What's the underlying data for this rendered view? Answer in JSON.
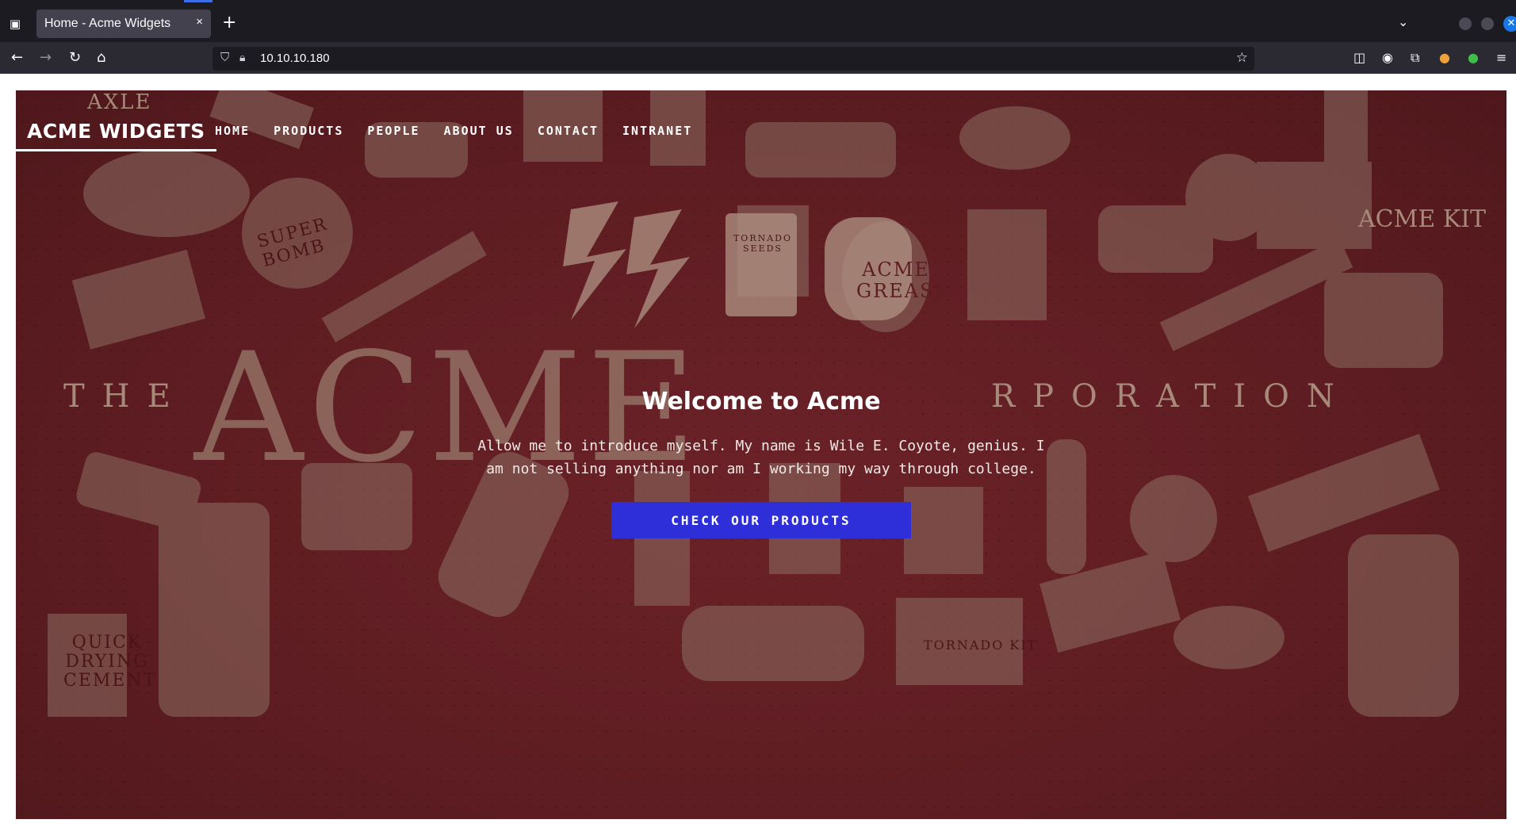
{
  "browser": {
    "tab_title": "Home - Acme Widgets",
    "tab_close": "×",
    "new_tab": "+",
    "url": "10.10.10.180"
  },
  "page": {
    "brand": "ACME WIDGETS",
    "menu": [
      "HOME",
      "PRODUCTS",
      "PEOPLE",
      "ABOUT US",
      "CONTACT",
      "INTRANET"
    ],
    "hero_title": "Welcome to Acme",
    "hero_text": "Allow me to introduce myself. My name is Wile E. Coyote, genius. I am not selling anything nor am I working my way through college.",
    "cta_label": "CHECK OUR PRODUCTS",
    "poster_text": {
      "the": "THE",
      "acme": "ACME",
      "corporation": "RPORATION",
      "axle": "AXLE",
      "grease_line1": "ACME",
      "grease_line2": "GREASE",
      "acme_kit": "ACME KIT",
      "super_bomb": "SUPER BOMB",
      "tornado_seeds": "TORNADO SEEDS",
      "tornado_kit": "TORNADO KIT",
      "cement_line1": "QUICK",
      "cement_line2": "DRYING",
      "cement_line3": "CEMENT"
    }
  },
  "colors": {
    "hero_bg": "#5e1d22",
    "cta_bg": "#2e2fd9",
    "browser_dark": "#1c1b22"
  }
}
